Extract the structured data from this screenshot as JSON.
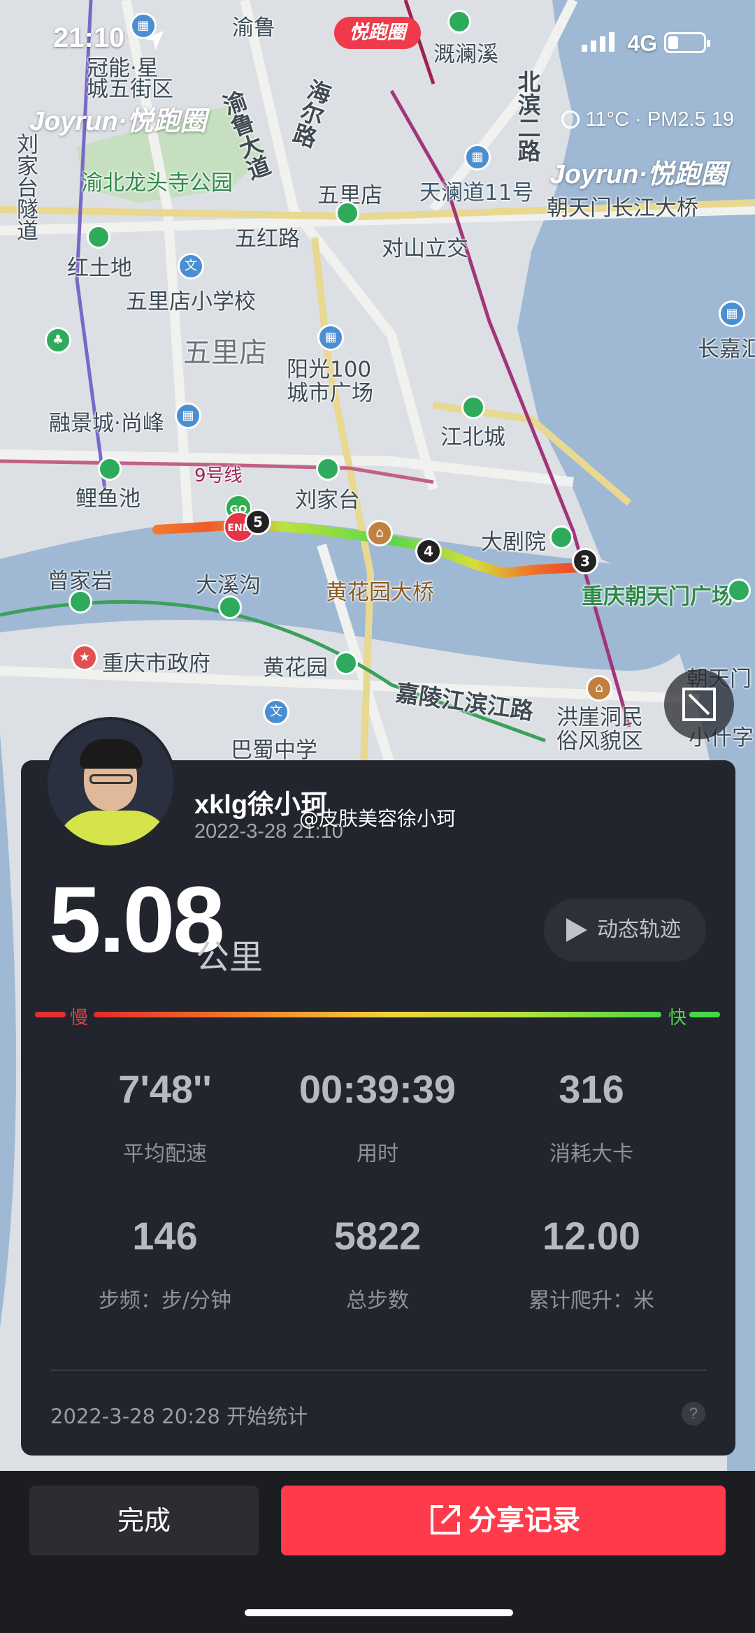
{
  "status_bar": {
    "time": "21:10",
    "network": "4G"
  },
  "app_badge": "悦跑圈",
  "watermark": {
    "brand": "Joyrun·悦跑圈"
  },
  "weather": {
    "text": "11°C · PM2.5 19"
  },
  "map": {
    "labels": {
      "yulu": "渝鲁",
      "jianlanxi": "溉澜溪",
      "guanying": "冠能·星",
      "wuli_jie": "城五街区",
      "longtousi": "渝北龙头寺公园",
      "liujia_tai_v": "刘家台隧道",
      "hongtudi": "红土地",
      "wulidian_school": "五里店小学校",
      "wulidian": "五里店",
      "wulidian_station": "五里店",
      "wuhonglu": "五红路",
      "duishan": "对山立交",
      "tianlan": "天澜道11号",
      "chaotianmen_bridge": "朝天门长江大桥",
      "yangguang": "阳光100城市广场",
      "rongjing": "融景城·尚峰",
      "jiangbei": "江北城",
      "line9": "9号线",
      "liyuchi": "鲤鱼池",
      "liujiatai": "刘家台",
      "dajuyuan": "大剧院",
      "huanghuayuan_bridge": "黄花园大桥",
      "zengjiayan": "曾家岩",
      "daxigou": "大溪沟",
      "chaotianmen_square": "重庆朝天门广场",
      "gov": "重庆市政府",
      "huanghuayuan": "黄花园",
      "jialing_road": "嘉陵江滨江路",
      "hongyadong": "洪崖洞民俗风貌区",
      "bashu": "巴蜀中学",
      "chaotianmen": "朝天门",
      "xiaoshizi": "小什字",
      "changjia": "长嘉汇",
      "yulu_ave": "渝鲁大道",
      "haier_road": "海尔路",
      "beibin_road": "北滨二路"
    }
  },
  "route": {
    "start": "GO",
    "end": "END",
    "km_markers": [
      "5",
      "4",
      "3"
    ]
  },
  "profile": {
    "username": "xklg徐小珂",
    "datetime": "2022-3-28 21:10",
    "weibo": "@皮肤美容徐小珂"
  },
  "summary": {
    "distance": "5.08",
    "distance_unit": "公里",
    "replay_label": "动态轨迹",
    "pace_slow": "慢",
    "pace_fast": "快"
  },
  "stats": [
    {
      "value": "7'48''",
      "label": "平均配速"
    },
    {
      "value": "00:39:39",
      "label": "用时"
    },
    {
      "value": "316",
      "label": "消耗大卡"
    },
    {
      "value": "146",
      "label": "步频：步/分钟"
    },
    {
      "value": "5822",
      "label": "总步数"
    },
    {
      "value": "12.00",
      "label": "累计爬升：米"
    }
  ],
  "footer": {
    "start_time": "2022-3-28 20:28 开始统计",
    "help": "?"
  },
  "actions": {
    "done": "完成",
    "share": "分享记录"
  },
  "colors": {
    "accent": "#ff3a4a",
    "card_bg": "#23252e",
    "slow": "#e53030",
    "fast": "#48d648"
  }
}
